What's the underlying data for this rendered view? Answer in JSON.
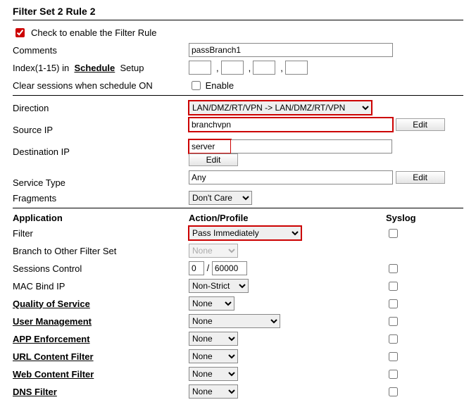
{
  "title": "Filter Set 2 Rule 2",
  "enable_label": "Check to enable the Filter Rule",
  "comments_label": "Comments",
  "comments_value": "passBranch1",
  "index_label_a": "Index(1-15) in",
  "index_schedule": "Schedule",
  "index_label_b": "Setup",
  "clear_label": "Clear sessions when schedule ON",
  "enable_checkbox_label": "Enable",
  "direction_label": "Direction",
  "direction_value": "LAN/DMZ/RT/VPN -> LAN/DMZ/RT/VPN",
  "source_label": "Source IP",
  "source_value": "branchvpn",
  "dest_label": "Destination IP",
  "dest_value": "server",
  "service_label": "Service Type",
  "service_value": "Any",
  "edit_label": "Edit",
  "fragments_label": "Fragments",
  "fragments_value": "Don't Care",
  "header_app": "Application",
  "header_action": "Action/Profile",
  "header_syslog": "Syslog",
  "filter_label": "Filter",
  "filter_value": "Pass Immediately",
  "branch_label": "Branch to Other Filter Set",
  "branch_value": "None",
  "sessions_label": "Sessions Control",
  "sessions_value": "0",
  "sessions_slash": "/",
  "sessions_max": "60000",
  "mac_label": "MAC Bind IP",
  "mac_value": "Non-Strict",
  "qos_label": "Quality of Service",
  "qos_value": "None",
  "user_label": "User Management",
  "user_value": "None",
  "app_label": "APP Enforcement",
  "app_value": "None",
  "url_label": "URL Content Filter",
  "url_value": "None",
  "web_label": "Web Content Filter",
  "web_value": "None",
  "dns_label": "DNS Filter",
  "dns_value": "None"
}
